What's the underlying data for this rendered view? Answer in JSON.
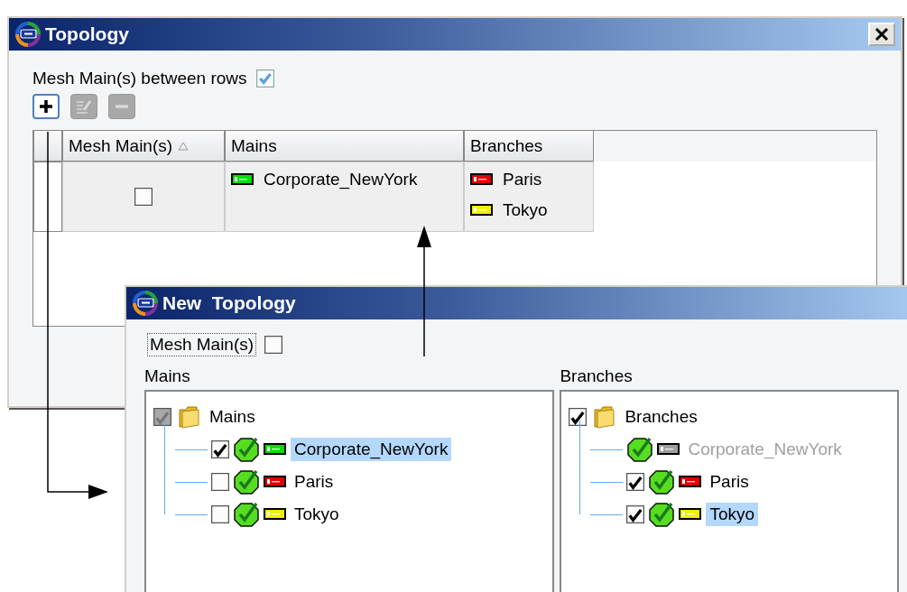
{
  "windows": [
    {
      "title": "Topology",
      "mesh_option": {
        "label": "Mesh Main(s) between rows",
        "checked": true
      },
      "toolbar": [
        {
          "kind": "add",
          "disabled": false
        },
        {
          "kind": "edit",
          "disabled": true
        },
        {
          "kind": "remove",
          "disabled": true
        }
      ],
      "table": {
        "columns": [
          {
            "label": "Mesh Main(s)",
            "sorted": true
          },
          {
            "label": "Mains",
            "sorted": false
          },
          {
            "label": "Branches",
            "sorted": false
          }
        ],
        "rows": [
          {
            "mesh": false,
            "mains": [
              {
                "name": "Corporate_NewYork",
                "color": "#00e000"
              }
            ],
            "branches": [
              {
                "name": "Paris",
                "color": "#e00000"
              },
              {
                "name": "Tokyo",
                "color": "#f0f000"
              }
            ]
          }
        ]
      }
    },
    {
      "title": "New  Topology",
      "mesh_option": {
        "label": "Mesh Main(s)",
        "checked": false,
        "focused": true
      },
      "panels": [
        {
          "label": "Mains",
          "tree": {
            "label": "Mains",
            "checked": true,
            "disabled": true,
            "children": [
              {
                "label": "Corporate_NewYork",
                "checked": true,
                "disabled": false,
                "selected": true,
                "color": "#00e000"
              },
              {
                "label": "Paris",
                "checked": false,
                "disabled": false,
                "selected": false,
                "color": "#e00000"
              },
              {
                "label": "Tokyo",
                "checked": false,
                "disabled": false,
                "selected": false,
                "color": "#f0f000"
              }
            ]
          }
        },
        {
          "label": "Branches",
          "tree": {
            "label": "Branches",
            "checked": true,
            "disabled": false,
            "children": [
              {
                "label": "Corporate_NewYork",
                "disabled": true,
                "selected": false,
                "color": "#a0a0a0"
              },
              {
                "label": "Paris",
                "checked": true,
                "disabled": false,
                "selected": false,
                "color": "#e00000"
              },
              {
                "label": "Tokyo",
                "checked": true,
                "disabled": false,
                "selected": true,
                "color": "#f0f000"
              }
            ]
          }
        }
      ]
    }
  ]
}
